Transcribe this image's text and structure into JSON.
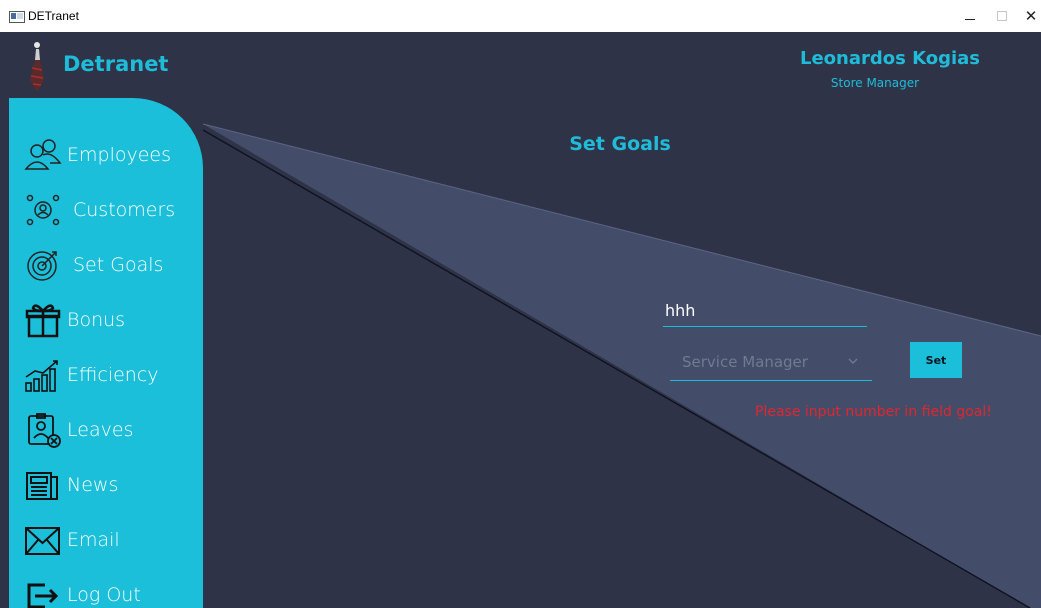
{
  "window": {
    "title": "DETranet"
  },
  "header": {
    "brand": "Detranet",
    "user_name": "Leonardos Kogias",
    "user_role": "Store Manager"
  },
  "sidebar": {
    "items": [
      {
        "label": "Employees",
        "icon": "employees-icon"
      },
      {
        "label": "Customers",
        "icon": "customers-icon"
      },
      {
        "label": "Set Goals",
        "icon": "target-icon"
      },
      {
        "label": "Bonus",
        "icon": "gift-icon"
      },
      {
        "label": "Efficiency",
        "icon": "chart-icon"
      },
      {
        "label": "Leaves",
        "icon": "leave-icon"
      },
      {
        "label": "News",
        "icon": "newspaper-icon"
      },
      {
        "label": "Email",
        "icon": "envelope-icon"
      },
      {
        "label": "Log Out",
        "icon": "logout-icon"
      }
    ]
  },
  "main": {
    "title": "Set Goals",
    "goal_value": "hhh",
    "role_selected": "Service Manager",
    "set_label": "Set",
    "error": "Please input number in field goal!"
  },
  "colors": {
    "accent": "#1bbfda",
    "background": "#2f3347",
    "panel": "#434c69",
    "error": "#e0262f"
  }
}
